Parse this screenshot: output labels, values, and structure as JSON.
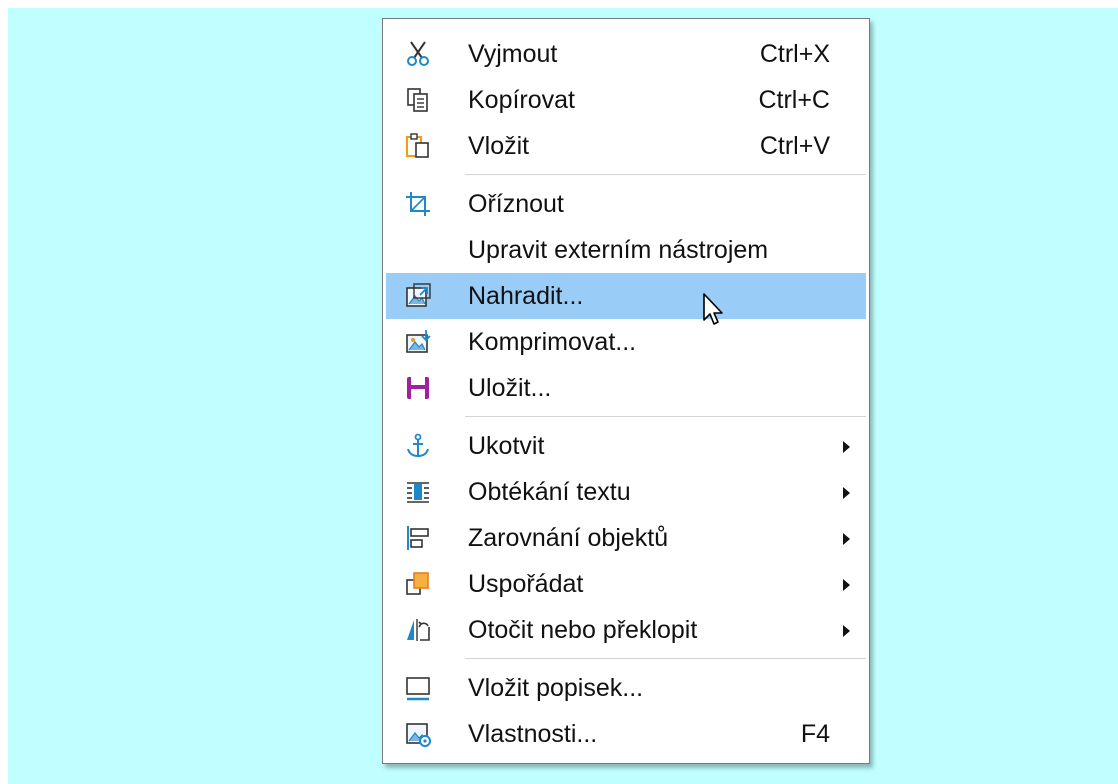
{
  "menu": {
    "items": [
      {
        "label": "Vyjmout",
        "shortcut": "Ctrl+X",
        "icon": "scissors-icon"
      },
      {
        "label": "Kopírovat",
        "shortcut": "Ctrl+C",
        "icon": "copy-icon"
      },
      {
        "label": "Vložit",
        "shortcut": "Ctrl+V",
        "icon": "paste-icon"
      },
      {
        "label": "Oříznout",
        "icon": "crop-icon"
      },
      {
        "label": "Upravit externím nástrojem"
      },
      {
        "label": "Nahradit...",
        "icon": "replace-image-icon",
        "highlighted": true
      },
      {
        "label": "Komprimovat...",
        "icon": "compress-image-icon"
      },
      {
        "label": "Uložit...",
        "icon": "save-icon"
      },
      {
        "label": "Ukotvit",
        "icon": "anchor-icon",
        "submenu": true
      },
      {
        "label": "Obtékání textu",
        "icon": "text-wrap-icon",
        "submenu": true
      },
      {
        "label": "Zarovnání objektů",
        "icon": "align-objects-icon",
        "submenu": true
      },
      {
        "label": "Uspořádat",
        "icon": "arrange-icon",
        "submenu": true
      },
      {
        "label": "Otočit nebo překlopit",
        "icon": "rotate-flip-icon",
        "submenu": true
      },
      {
        "label": "Vložit popisek...",
        "icon": "insert-caption-icon"
      },
      {
        "label": "Vlastnosti...",
        "shortcut": "F4",
        "icon": "properties-icon"
      }
    ]
  },
  "colors": {
    "background": "#bfffff",
    "highlight": "#99ccf6",
    "accent_blue": "#1e88c8",
    "accent_orange": "#f39c12",
    "accent_purple": "#a020a0"
  }
}
